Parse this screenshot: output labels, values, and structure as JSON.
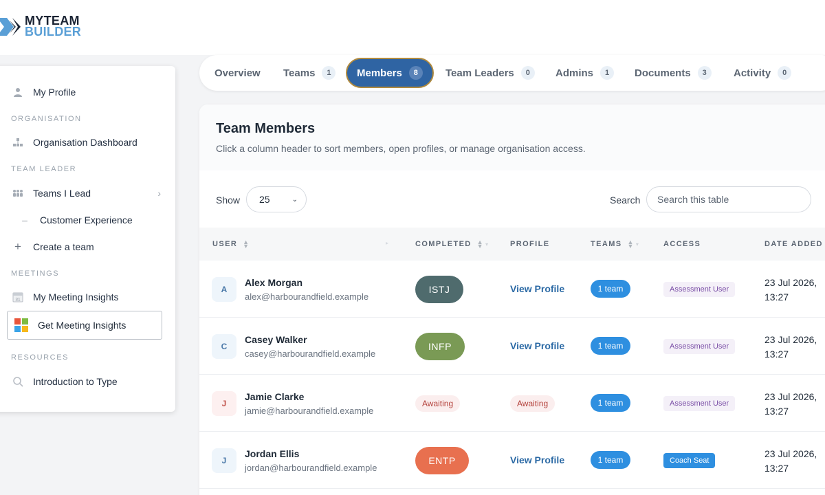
{
  "brand": {
    "line1": "MYTEAM",
    "line2": "BUILDER"
  },
  "sidebar": {
    "profile": "My Profile",
    "sections": {
      "organisation": "ORGANISATION",
      "team_leader": "TEAM LEADER",
      "meetings": "MEETINGS",
      "resources": "RESOURCES"
    },
    "org_dashboard": "Organisation Dashboard",
    "teams_i_lead": "Teams I Lead",
    "customer_experience": "Customer Experience",
    "create_team": "Create a team",
    "my_meeting_insights": "My Meeting Insights",
    "get_meeting_insights": "Get Meeting Insights",
    "intro_to_type": "Introduction to Type",
    "calendar_day": "31"
  },
  "tabs": [
    {
      "label": "Overview",
      "count": ""
    },
    {
      "label": "Teams",
      "count": "1"
    },
    {
      "label": "Members",
      "count": "8"
    },
    {
      "label": "Team Leaders",
      "count": "0"
    },
    {
      "label": "Admins",
      "count": "1"
    },
    {
      "label": "Documents",
      "count": "3"
    },
    {
      "label": "Activity",
      "count": "0"
    }
  ],
  "card": {
    "title": "Team Members",
    "subtitle": "Click a column header to sort members, open profiles, or manage organisation access."
  },
  "controls": {
    "show_label": "Show",
    "show_value": "25",
    "search_label": "Search",
    "search_placeholder": "Search this table"
  },
  "columns": {
    "user": "USER",
    "completed": "COMPLETED",
    "profile": "PROFILE",
    "teams": "TEAMS",
    "access": "ACCESS",
    "date_added": "DATE ADDED"
  },
  "rows": [
    {
      "initial": "A",
      "name": "Alex Morgan",
      "email": "alex@harbourandfield.example",
      "completed": "ISTJ",
      "profile": "View Profile",
      "teams": "1 team",
      "access": "Assessment User",
      "date": "23 Jul 2026,",
      "time": "13:27"
    },
    {
      "initial": "C",
      "name": "Casey Walker",
      "email": "casey@harbourandfield.example",
      "completed": "INFP",
      "profile": "View Profile",
      "teams": "1 team",
      "access": "Assessment User",
      "date": "23 Jul 2026,",
      "time": "13:27"
    },
    {
      "initial": "J",
      "name": "Jamie Clarke",
      "email": "jamie@harbourandfield.example",
      "completed": "Awaiting",
      "profile": "Awaiting",
      "teams": "1 team",
      "access": "Assessment User",
      "date": "23 Jul 2026,",
      "time": "13:27"
    },
    {
      "initial": "J",
      "name": "Jordan Ellis",
      "email": "jordan@harbourandfield.example",
      "completed": "ENTP",
      "profile": "View Profile",
      "teams": "1 team",
      "access": "Coach Seat",
      "date": "23 Jul 2026,",
      "time": "13:27"
    }
  ],
  "colors": {
    "accent": "#2f64a3",
    "istj": "#4f6b6d",
    "infp": "#7a9a55",
    "entp": "#e8704f",
    "team_pill": "#2e8fe0"
  },
  "icons": [
    "person-icon",
    "org-chart-icon",
    "people-icon",
    "chevron-right-icon",
    "dash-icon",
    "plus-icon",
    "calendar-icon",
    "microsoft-logo-icon",
    "search-icon",
    "sort-icon",
    "chevron-down-icon"
  ]
}
